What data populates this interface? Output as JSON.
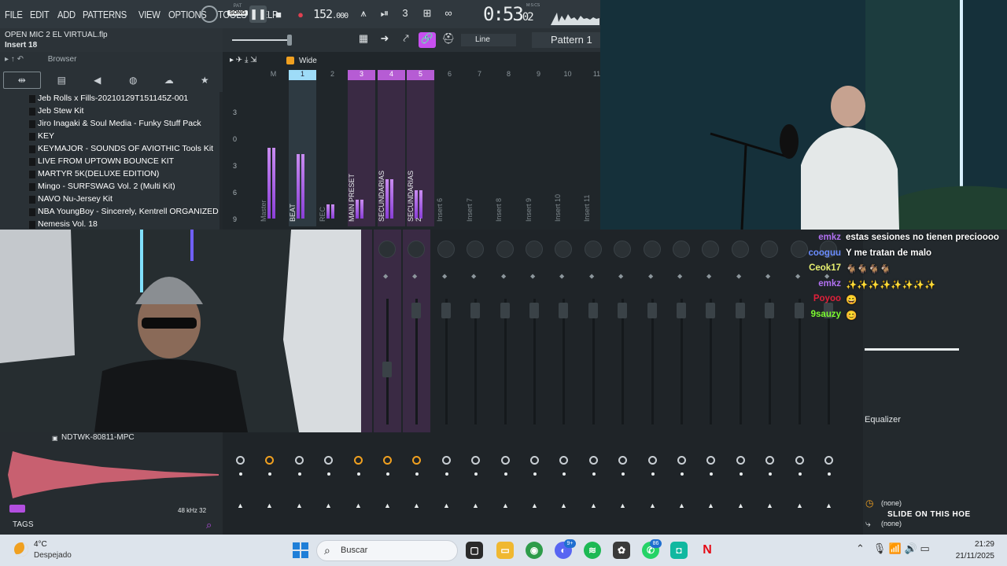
{
  "menu": {
    "items": [
      "FILE",
      "EDIT",
      "ADD",
      "PATTERNS",
      "VIEW",
      "OPTIONS",
      "TOOLS",
      "HELP"
    ]
  },
  "transport": {
    "pat_label": "PAT",
    "song_label": "SONG",
    "tempo": "152",
    "tempo_decimal": ".000",
    "time_main": "0:53",
    "time_sub": "02",
    "time_unit": "M:S:CS",
    "snap_value": "Line",
    "pattern": "Pattern 1"
  },
  "project": {
    "file_name": "OPEN MIC 2 EL VIRTUAL.flp",
    "insert": "Insert 18"
  },
  "browser": {
    "title": "Browser",
    "items": [
      "Jeb Rolls x Fills-20210129T151145Z-001",
      "Jeb Stew Kit",
      "Jiro Inagaki & Soul Media - Funky Stuff Pack",
      "KEY",
      "KEYMAJOR - SOUNDS OF AVIOTHIC Tools Kit",
      "LIVE FROM UPTOWN BOUNCE KIT",
      "MARTYR 5K(DELUXE EDITION)",
      "Mingo - SURFSWAG Vol. 2 (Multi Kit)",
      "NAVO Nu-Jersey Kit",
      "NBA YoungBoy - Sincerely, Kentrell ORGANIZED Drum Kit",
      "Nemesis Vol. 18"
    ]
  },
  "mixer": {
    "stereo_mode": "Wide",
    "db_scale": [
      "3",
      "0",
      "3",
      "6",
      "9"
    ],
    "channels": [
      {
        "num": "M",
        "name": "Master",
        "level": 0.75
      },
      {
        "num": "1",
        "name": "BEAT",
        "level": 0.68
      },
      {
        "num": "2",
        "name": "REC",
        "level": 0.15
      },
      {
        "num": "3",
        "name": "MAIN PRESET",
        "level": 0.2
      },
      {
        "num": "4",
        "name": "SECUNDARIAS",
        "level": 0.42
      },
      {
        "num": "5",
        "name": "SECUNDARIAS 2",
        "level": 0.3
      },
      {
        "num": "6",
        "name": "Insert 6",
        "level": 0
      },
      {
        "num": "7",
        "name": "Insert 7",
        "level": 0
      },
      {
        "num": "8",
        "name": "Insert 8",
        "level": 0
      },
      {
        "num": "9",
        "name": "Insert 9",
        "level": 0
      },
      {
        "num": "10",
        "name": "Insert 10",
        "level": 0
      },
      {
        "num": "11",
        "name": "Insert 11",
        "level": 0
      }
    ]
  },
  "sample": {
    "name": "NDTWK-80811-MPC",
    "rate": "48 kHz",
    "bits": "32",
    "tags_label": "TAGS"
  },
  "fx_panel": {
    "equalizer_label": "Equalizer",
    "slot1": "(none)",
    "slot2": "(none)",
    "overlay_text": "SLIDE ON THIS HOE"
  },
  "chat": [
    {
      "user": "emkz",
      "color": "#b070f0",
      "message": "estas sesiones no tienen precioooo"
    },
    {
      "user": "cooguu",
      "color": "#6a8cff",
      "message": "Y me tratan de malo"
    },
    {
      "user": "Ceok17",
      "color": "#e8f070",
      "message": "🐐🐐🐐🐐"
    },
    {
      "user": "emkz",
      "color": "#b070f0",
      "message": "✨✨✨✨✨✨✨✨"
    },
    {
      "user": "Poyoo",
      "color": "#e0203a",
      "message": "😄"
    },
    {
      "user": "9sauzy",
      "color": "#7cfc30",
      "message": "😊"
    }
  ],
  "taskbar": {
    "weather_temp": "4°C",
    "weather_desc": "Despejado",
    "search_placeholder": "Buscar",
    "discord_badge": "9+",
    "whatsapp_badge": "86",
    "time": "21:29",
    "date": "21/11/2025"
  },
  "colors": {
    "accent_purple": "#c84ff0",
    "selected_blue": "#9edcf8",
    "knob_orange": "#f0a020"
  }
}
